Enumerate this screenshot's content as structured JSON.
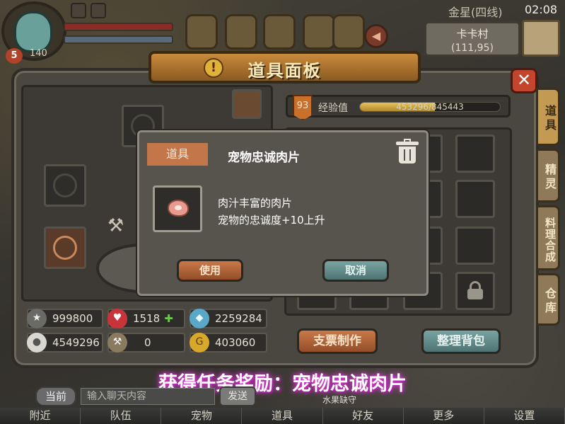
{
  "hud": {
    "player_level": "5",
    "player_exp": "140",
    "server": "金星(四线)",
    "time": "02:08",
    "location_name": "卡卡村",
    "location_coords": "(111,95)"
  },
  "panel": {
    "title": "道具面板",
    "close_label": "✕"
  },
  "side_tabs": [
    "道具",
    "精灵",
    "料理合成",
    "仓库"
  ],
  "stats": [
    {
      "icon": "star-medal-icon",
      "value": "999800"
    },
    {
      "icon": "heart-icon",
      "value": "1518",
      "extra": "✚"
    },
    {
      "icon": "diamond-icon",
      "value": "2259284"
    },
    {
      "icon": "pearl-icon",
      "value": "4549296"
    },
    {
      "icon": "hammer-icon",
      "value": "0"
    },
    {
      "icon": "gold-coin-icon",
      "value": "403060"
    }
  ],
  "experience": {
    "level": "93",
    "label": "经验值",
    "text": "453296/845443",
    "fraction": 0.536
  },
  "buttons": {
    "craft": "支票制作",
    "sort": "整理背包"
  },
  "dialog": {
    "tag": "道具",
    "title": "宠物忠诚肉片",
    "line1": "肉汁丰富的肉片",
    "line2": "宠物的忠诚度+10上升",
    "use_label": "使用",
    "cancel_label": "取消"
  },
  "reward_text": "获得任务奖励：宠物忠诚肉片",
  "chat": {
    "channel_label": "当前",
    "input_placeholder": "输入聊天内容",
    "send_label": "发送",
    "hint": "水果缺守"
  },
  "bottom_tabs": [
    "附近",
    "队伍",
    "宠物",
    "道具",
    "好友",
    "更多",
    "设置"
  ],
  "colors": {
    "accent_orange": "#c2764a",
    "teal": "#79a4a2",
    "reward_glow": "#d83ad0"
  }
}
